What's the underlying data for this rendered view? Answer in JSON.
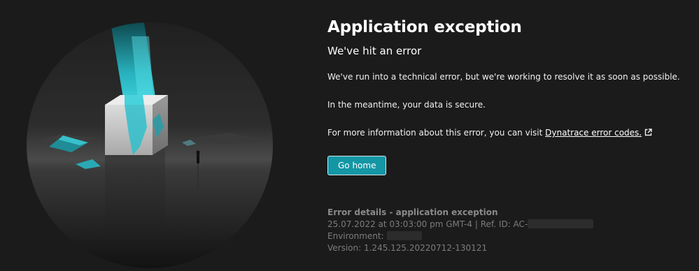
{
  "page": {
    "title": "Application exception",
    "subtitle": "We've hit an error",
    "paragraph_1": "We've run into a technical error, but we're working to resolve it as soon as possible.",
    "paragraph_2": "In the meantime, your data is secure.",
    "paragraph_3_prefix": "For more information about this error, you can visit ",
    "paragraph_3_link": "Dynatrace error codes.",
    "go_home_label": "Go home"
  },
  "details": {
    "title": "Error details - application exception",
    "timestamp_line": "25.07.2022 at 03:03:00 pm GMT-4 | Ref. ID: AC-",
    "environment_label": "Environment:",
    "version_line": "Version: 1.245.125.20220712-130121"
  },
  "icons": {
    "external_link": "external-link-icon"
  },
  "colors": {
    "background": "#1b1b1b",
    "button": "#1496a5",
    "accent_cyan": "#2ec4cf",
    "muted_text": "#7c7c7c"
  }
}
